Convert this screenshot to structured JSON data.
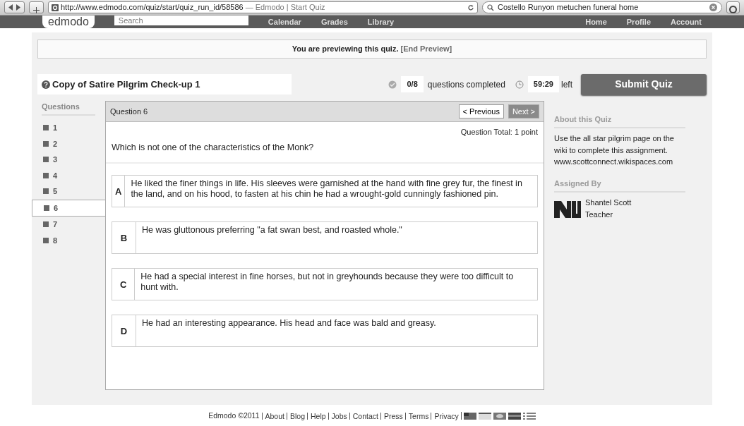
{
  "browser": {
    "url": "http://www.edmodo.com/quiz/start/quiz_run_id/58586",
    "page_title": "— Edmodo | Start Quiz",
    "search_value": "Costello Runyon metuchen funeral home"
  },
  "site_nav": {
    "logo": "edmodo",
    "search_placeholder": "Search",
    "left_links": [
      "Calendar",
      "Grades",
      "Library"
    ],
    "right_links": [
      "Home",
      "Profile",
      "Account"
    ]
  },
  "preview_banner": {
    "text": "You are previewing this quiz.",
    "link": "[End Preview]"
  },
  "quiz": {
    "title": "Copy of Satire Pilgrim Check-up 1",
    "completed": "0/8",
    "completed_label": "questions completed",
    "time": "59:29",
    "time_label": "left",
    "submit": "Submit Quiz"
  },
  "questions_nav": {
    "heading": "Questions",
    "items": [
      {
        "label": "1",
        "selected": false
      },
      {
        "label": "2",
        "selected": false
      },
      {
        "label": "3",
        "selected": false
      },
      {
        "label": "4",
        "selected": false
      },
      {
        "label": "5",
        "selected": false
      },
      {
        "label": "6",
        "selected": true
      },
      {
        "label": "7",
        "selected": false
      },
      {
        "label": "8",
        "selected": false
      }
    ]
  },
  "question": {
    "heading": "Question 6",
    "previous": "< Previous",
    "next": "Next >",
    "next_disabled": true,
    "total": "Question Total: 1 point",
    "text": "Which is not one of the characteristics of the Monk?",
    "answers": [
      {
        "letter": "A",
        "text": "He liked the finer things in life. His sleeves were garnished at the hand with fine grey fur, the finest in the land, and on his hood, to fasten at his chin he had a wrought-gold cunningly fashioned pin."
      },
      {
        "letter": "B",
        "text": "He was gluttonous preferring \"a fat swan best, and roasted whole.\""
      },
      {
        "letter": "C",
        "text": "He had a special interest in fine horses, but not in greyhounds because they were too difficult to hunt with."
      },
      {
        "letter": "D",
        "text": "He had an interesting appearance. His head and face was bald and greasy."
      }
    ]
  },
  "sidebar": {
    "about_heading": "About this Quiz",
    "about_text": "Use the all star pilgrim page on the wiki to complete this assignment. www.scottconnect.wikispaces.com",
    "assigned_heading": "Assigned By",
    "teacher_name": "Shantel Scott",
    "teacher_role": "Teacher"
  },
  "footer": {
    "copyright": "Edmodo ©2011",
    "links": [
      "About",
      "Blog",
      "Help",
      "Jobs",
      "Contact",
      "Press",
      "Terms",
      "Privacy"
    ]
  }
}
